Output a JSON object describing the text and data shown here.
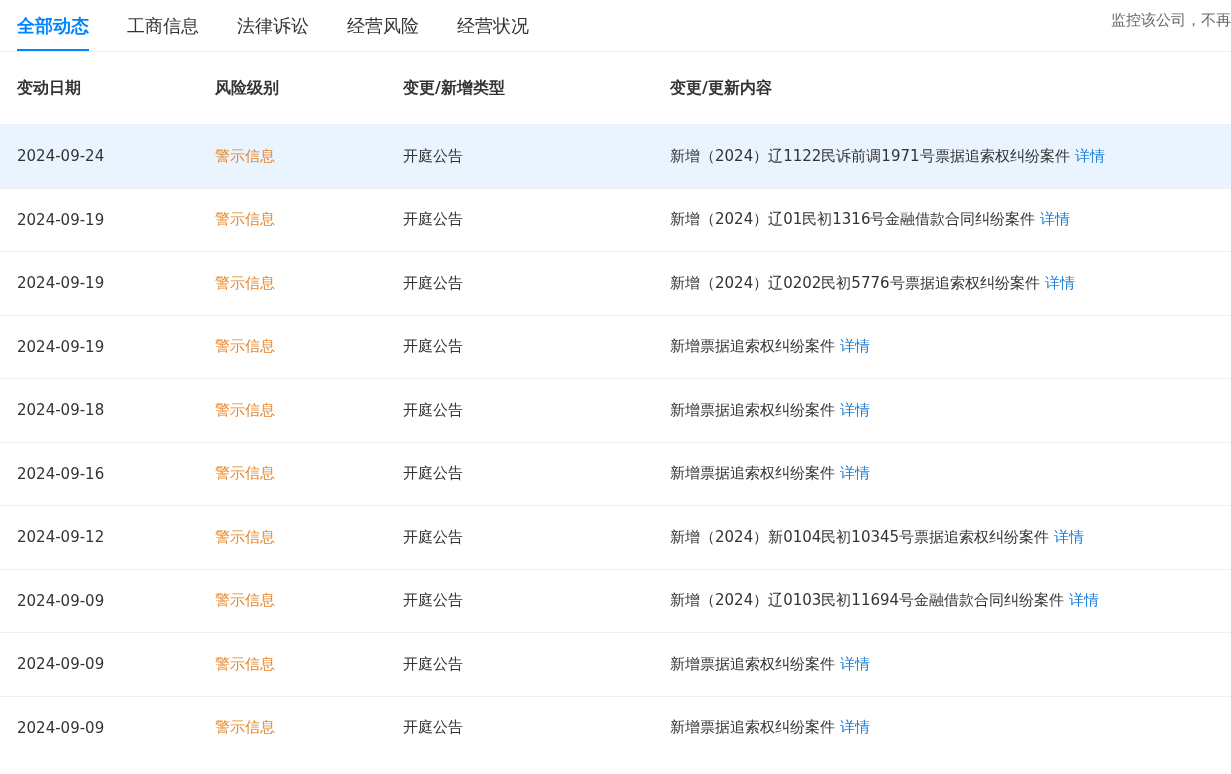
{
  "tabs": [
    {
      "label": "全部动态",
      "selected": true
    },
    {
      "label": "工商信息",
      "selected": false
    },
    {
      "label": "法律诉讼",
      "selected": false
    },
    {
      "label": "经营风险",
      "selected": false
    },
    {
      "label": "经营状况",
      "selected": false
    }
  ],
  "monitor_text": "监控该公司，不再",
  "table": {
    "columns": [
      "变动日期",
      "风险级别",
      "变更/新增类型",
      "变更/更新内容"
    ],
    "rows": [
      {
        "date": "2024-09-24",
        "risk": "警示信息",
        "type": "开庭公告",
        "content": "新增（2024）辽1122民诉前调1971号票据追索权纠纷案件",
        "link": "详情",
        "selected": true
      },
      {
        "date": "2024-09-19",
        "risk": "警示信息",
        "type": "开庭公告",
        "content": "新增（2024）辽01民初1316号金融借款合同纠纷案件",
        "link": "详情",
        "selected": false
      },
      {
        "date": "2024-09-19",
        "risk": "警示信息",
        "type": "开庭公告",
        "content": "新增（2024）辽0202民初5776号票据追索权纠纷案件",
        "link": "详情",
        "selected": false
      },
      {
        "date": "2024-09-19",
        "risk": "警示信息",
        "type": "开庭公告",
        "content": "新增票据追索权纠纷案件",
        "link": "详情",
        "selected": false
      },
      {
        "date": "2024-09-18",
        "risk": "警示信息",
        "type": "开庭公告",
        "content": "新增票据追索权纠纷案件",
        "link": "详情",
        "selected": false
      },
      {
        "date": "2024-09-16",
        "risk": "警示信息",
        "type": "开庭公告",
        "content": "新增票据追索权纠纷案件",
        "link": "详情",
        "selected": false
      },
      {
        "date": "2024-09-12",
        "risk": "警示信息",
        "type": "开庭公告",
        "content": "新增（2024）新0104民初10345号票据追索权纠纷案件",
        "link": "详情",
        "selected": false
      },
      {
        "date": "2024-09-09",
        "risk": "警示信息",
        "type": "开庭公告",
        "content": "新增（2024）辽0103民初11694号金融借款合同纠纷案件",
        "link": "详情",
        "selected": false
      },
      {
        "date": "2024-09-09",
        "risk": "警示信息",
        "type": "开庭公告",
        "content": "新增票据追索权纠纷案件",
        "link": "详情",
        "selected": false
      },
      {
        "date": "2024-09-09",
        "risk": "警示信息",
        "type": "开庭公告",
        "content": "新增票据追索权纠纷案件",
        "link": "详情",
        "selected": false
      }
    ]
  }
}
